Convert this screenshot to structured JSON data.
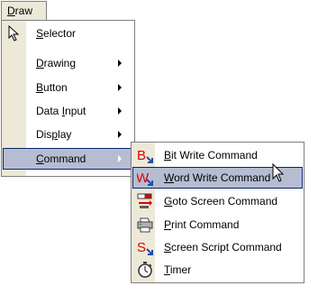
{
  "menubar": {
    "title_mnemonic": "D",
    "title_rest": "raw"
  },
  "draw_menu": {
    "items": [
      {
        "mn": "S",
        "rest": "elector",
        "icon": "selector-arrow-icon"
      },
      {
        "mn": "D",
        "rest": "rawing",
        "has_submenu": true
      },
      {
        "mn": "B",
        "rest": "utton",
        "has_submenu": true
      },
      {
        "pre": "Data ",
        "mn": "I",
        "rest": "nput",
        "has_submenu": true
      },
      {
        "pre": "Dis",
        "mn": "p",
        "rest": "lay",
        "has_submenu": true
      },
      {
        "mn": "C",
        "rest": "ommand",
        "has_submenu": true,
        "highlighted": true
      }
    ]
  },
  "command_menu": {
    "items": [
      {
        "mn": "B",
        "rest": "it Write Command",
        "icon": "bit-write-icon"
      },
      {
        "mn": "W",
        "rest": "ord Write Command",
        "icon": "word-write-icon",
        "highlighted": true
      },
      {
        "mn": "G",
        "rest": "oto Screen Command",
        "icon": "goto-screen-icon"
      },
      {
        "mn": "P",
        "rest": "rint Command",
        "icon": "printer-icon"
      },
      {
        "mn": "S",
        "rest": "creen Script Command",
        "icon": "screen-script-icon"
      },
      {
        "mn": "T",
        "rest": "imer",
        "icon": "stopwatch-icon"
      }
    ]
  },
  "colors": {
    "menu_bg": "#ffffff",
    "gutter": "#ece9d8",
    "highlight": "#b6bdd2",
    "highlight_border": "#0a246a"
  }
}
